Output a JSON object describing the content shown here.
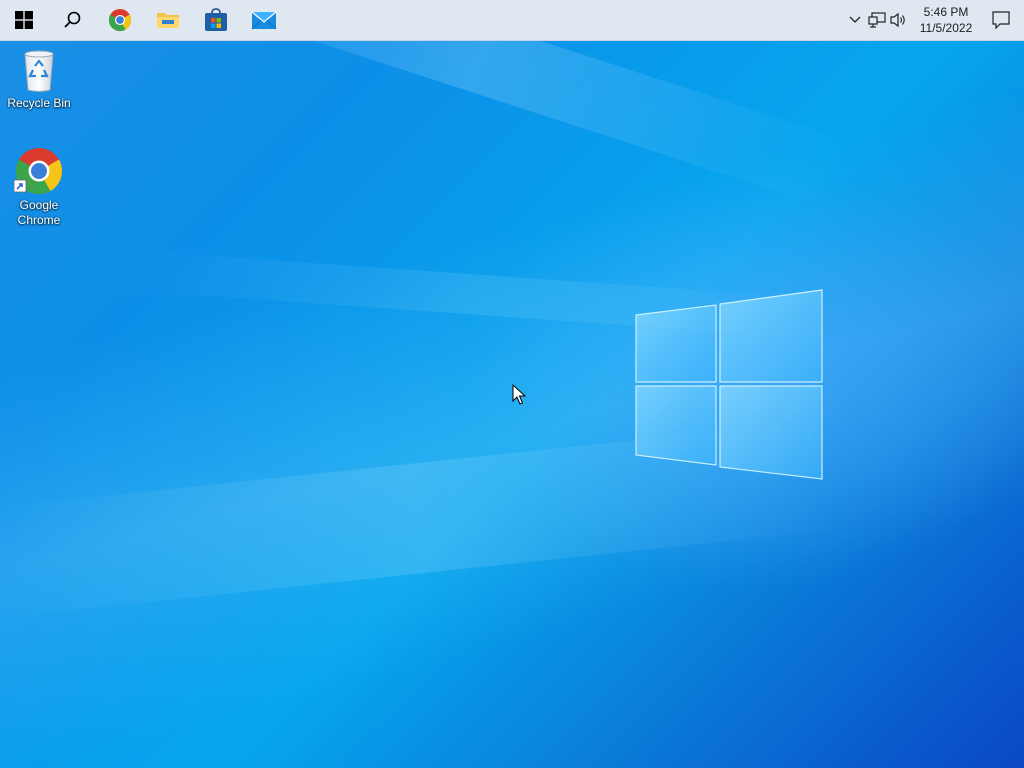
{
  "taskbar": {
    "pinned": [
      {
        "name": "start",
        "icon": "windows-logo-icon"
      },
      {
        "name": "search",
        "icon": "search-icon"
      },
      {
        "name": "chrome",
        "icon": "chrome-icon"
      },
      {
        "name": "file-explorer",
        "icon": "folder-icon"
      },
      {
        "name": "store",
        "icon": "store-icon"
      },
      {
        "name": "mail",
        "icon": "mail-icon"
      }
    ],
    "tray": {
      "icons": [
        "chevron-up-icon",
        "network-icon",
        "volume-icon"
      ],
      "time": "5:46 PM",
      "date": "11/5/2022",
      "notification_icon": "notification-icon"
    },
    "background_color": "#dfe7f1"
  },
  "desktop": {
    "icons": [
      {
        "label": "Recycle Bin",
        "icon": "recycle-bin-icon"
      },
      {
        "label": "Google Chrome",
        "icon": "chrome-icon",
        "shortcut": true
      }
    ],
    "accent_colors": {
      "wallpaper_light": "#06a6ee",
      "wallpaper_dark": "#0a47c4"
    }
  }
}
